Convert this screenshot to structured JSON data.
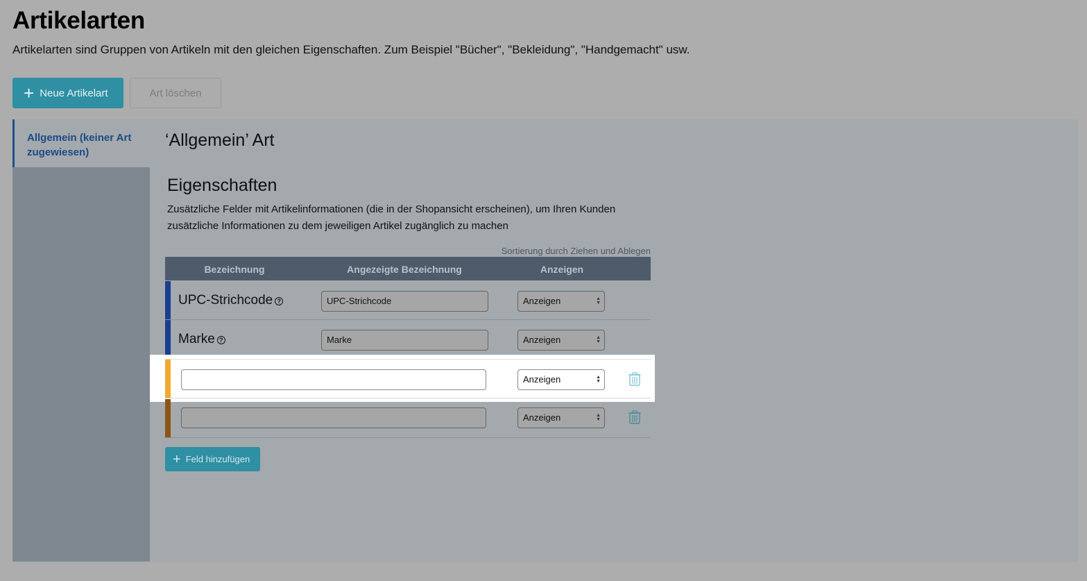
{
  "header": {
    "title": "Artikelarten",
    "description": "Artikelarten sind Gruppen von Artikeln mit den gleichen Eigenschaften. Zum Beispiel \"Bücher\", \"Bekleidung\", \"Handgemacht\" usw."
  },
  "toolbar": {
    "new_label": "Neue Artikelart",
    "delete_label": "Art löschen"
  },
  "sidebar": {
    "items": [
      {
        "label": "Allgemein (keiner Art zugewiesen)",
        "active": true
      }
    ]
  },
  "main": {
    "type_title": "‘Allgemein’ Art",
    "properties_title": "Eigenschaften",
    "properties_desc": "Zusätzliche Felder mit Artikelinformationen (die in der Shopansicht erscheinen), um Ihren Kunden zusätzliche Informationen zu dem jeweiligen Artikel zugänglich zu machen",
    "sort_hint": "Sortierung durch Ziehen und Ablegen",
    "columns": [
      "Bezeichnung",
      "Angezeigte Bezeichnung",
      "Anzeigen"
    ],
    "rows": [
      {
        "name": "UPC-Strichcode",
        "display_value": "UPC-Strichcode",
        "visibility": "Anzeigen",
        "bar_color": "#1a3f8f",
        "builtin": true
      },
      {
        "name": "Marke",
        "display_value": "Marke",
        "visibility": "Anzeigen",
        "bar_color": "#1a3f8f",
        "builtin": true
      },
      {
        "name": "",
        "name_value": "",
        "visibility": "Anzeigen",
        "bar_color": "#f0a92e",
        "builtin": false,
        "highlighted": true
      },
      {
        "name": "",
        "name_value": "",
        "visibility": "Anzeigen",
        "bar_color": "#8a5514",
        "builtin": false
      }
    ],
    "add_field_label": "Feld hinzufügen"
  },
  "colors": {
    "primary": "#2f8fa3",
    "table_header": "#4d5b6a",
    "sidebar_active": "#1d4a86"
  },
  "icons": {
    "add": "plus-icon",
    "info": "question-circle-icon",
    "delete": "trash-icon",
    "select": "updown-arrows-icon"
  }
}
